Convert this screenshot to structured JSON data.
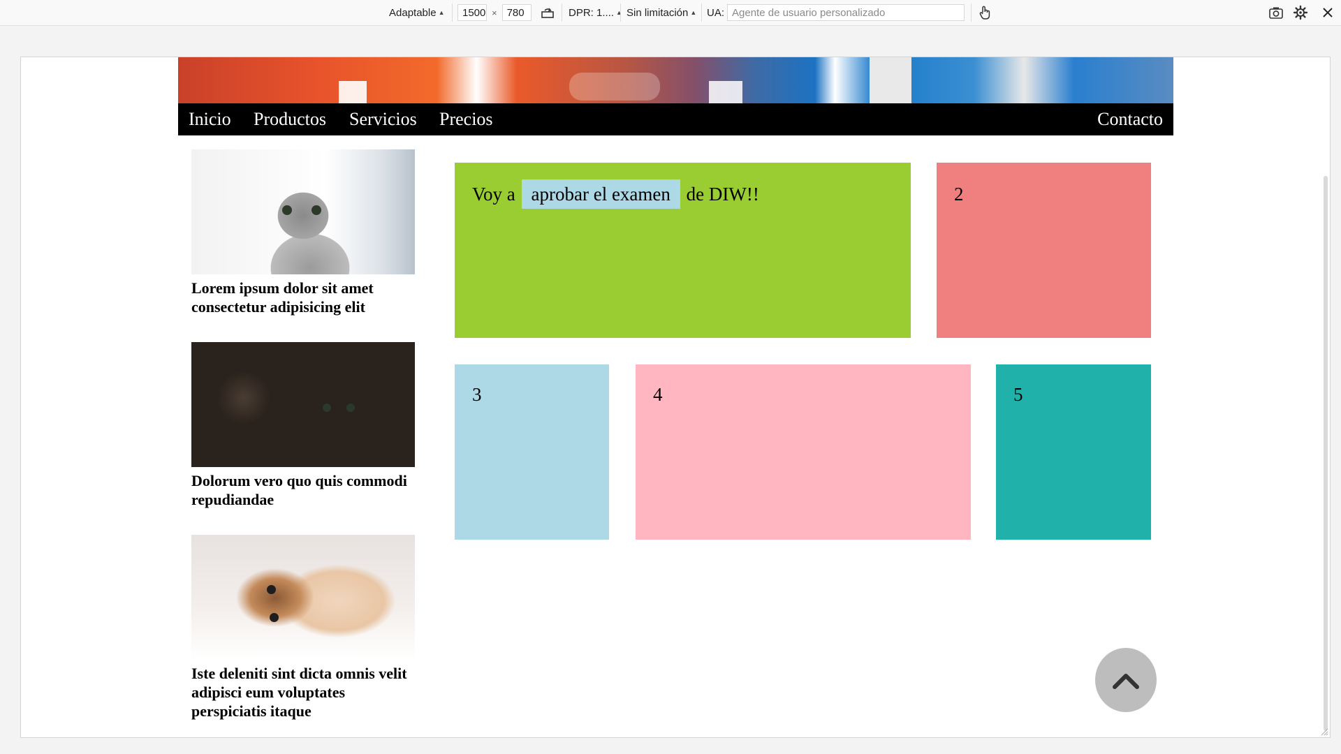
{
  "toolbar": {
    "device_select": "Adaptable",
    "width": "1500",
    "times": "×",
    "height": "780",
    "dpr_label": "DPR: 1....",
    "throttle": "Sin limitación",
    "ua_label": "UA:",
    "ua_placeholder": "Agente de usuario personalizado",
    "icons": [
      "rotate-icon",
      "touch-icon",
      "screenshot-icon",
      "settings-icon",
      "close-icon"
    ]
  },
  "nav": {
    "items": [
      "Inicio",
      "Productos",
      "Servicios",
      "Precios"
    ],
    "contact": "Contacto"
  },
  "sidebar": {
    "cards": [
      {
        "title": "Lorem ipsum dolor sit amet consectetur adipisicing elit",
        "image": "kitten-sitting"
      },
      {
        "title": "Dolorum vero quo quis commodi repudiandae",
        "image": "kitten-with-toy"
      },
      {
        "title": "Iste deleniti sint dicta omnis velit adipisci eum voluptates perspiciatis itaque",
        "image": "kitten-lying"
      }
    ]
  },
  "boxes": {
    "box1": {
      "before": "Voy a",
      "highlight": "aprobar el examen",
      "after": "de DIW!!",
      "color": "#9acd32"
    },
    "box2": {
      "label": "2",
      "color": "#f08080"
    },
    "box3": {
      "label": "3",
      "color": "#add8e6"
    },
    "box4": {
      "label": "4",
      "color": "#ffb6c1"
    },
    "box5": {
      "label": "5",
      "color": "#20b2aa"
    }
  },
  "back_to_top": {
    "icon": "chevron-up-icon"
  }
}
